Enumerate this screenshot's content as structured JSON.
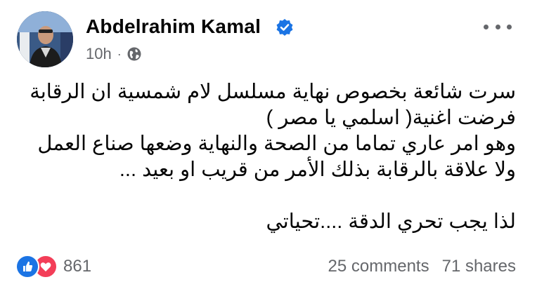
{
  "post": {
    "author": "Abdelrahim Kamal",
    "time": "10h",
    "separator": "·",
    "body_lines": [
      "سرت شائعة بخصوص نهاية مسلسل لام شمسية ان الرقابة",
      "فرضت اغنية( اسلمي يا مصر )",
      "وهو امر عاري تماما من الصحة والنهاية وضعها صناع العمل",
      "ولا علاقة بالرقابة بذلك الأمر من قريب او بعيد ...",
      "",
      "لذا يجب تحري الدقة ....تحياتي"
    ],
    "reaction_count": "861",
    "comments": "25 comments",
    "shares": "71 shares"
  },
  "icons": {
    "verified": "verified-badge-icon",
    "audience": "globe-icon",
    "more": "more-options-icon",
    "reactions": [
      "like-icon",
      "love-icon"
    ]
  },
  "colors": {
    "verified_blue": "#1b74e4",
    "secondary_text": "#65676b",
    "love_red": "#f33e58"
  }
}
